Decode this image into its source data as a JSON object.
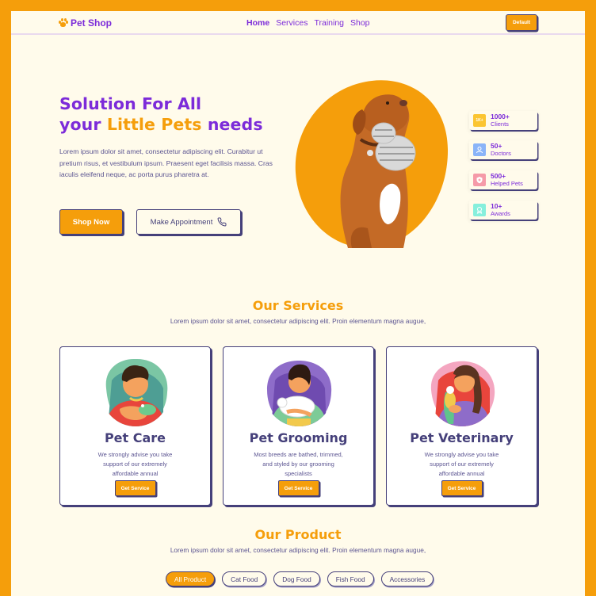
{
  "nav": {
    "brand": "Pet Shop",
    "links": [
      "Home",
      "Services",
      "Training",
      "Shop"
    ],
    "active_link": "Home",
    "button_label": "Default"
  },
  "hero": {
    "title_line1": "Solution For All",
    "title_line2_prefix": "your",
    "title_line2_accent": "Little Pets",
    "title_line2_suffix": "needs",
    "description": "Lorem ipsum dolor sit amet, consectetur adipiscing elit. Curabitur ut pretium risus, et vestibulum ipsum. Praesent eget facilisis massa. Cras iaculis eleifend neque, ac porta purus pharetra at.",
    "primary_button": "Shop Now",
    "secondary_button": "Make Appointment",
    "image": "dog-with-toy-photo"
  },
  "stats": [
    {
      "value": "1000+",
      "label": "Clients",
      "icon": "clients-icon",
      "color": "#FBC531"
    },
    {
      "value": "50+",
      "label": "Doctors",
      "icon": "doctor-icon",
      "color": "#8AB4F8"
    },
    {
      "value": "500+",
      "label": "Helped Pets",
      "icon": "shield-icon",
      "color": "#F59AA8"
    },
    {
      "value": "10+",
      "label": "Awards",
      "icon": "award-icon",
      "color": "#86EFDC"
    }
  ],
  "services": {
    "title": "Our Services",
    "subtitle": "Lorem ipsum dolor sit amet, consectetur adipiscing elit. Proin elementum magna augue,",
    "cards": [
      {
        "title": "Pet Care",
        "description": "We strongly advise you take support of our extremely affordable annual",
        "button": "Get Service",
        "illustration": "man-holding-frog"
      },
      {
        "title": "Pet Grooming",
        "description": "Most breeds are bathed, trimmed, and styled by our grooming specialists",
        "button": "Get Service",
        "illustration": "man-holding-sheep"
      },
      {
        "title": "Pet Veterinary",
        "description": "We strongly advise you take support of our extremely affordable annual",
        "button": "Get Service",
        "illustration": "woman-holding-parrot"
      }
    ]
  },
  "products": {
    "title": "Our Product",
    "subtitle": "Lorem ipsum dolor sit amet, consectetur adipiscing elit. Proin elementum magna augue,",
    "filters": [
      "All Product",
      "Cat Food",
      "Dog Food",
      "Fish Food",
      "Accessories"
    ],
    "active_filter": "All Product"
  },
  "colors": {
    "frame": "#F59E0B",
    "background": "#FFFBEB",
    "primary": "#7C2BD9",
    "accent": "#F59E0B",
    "ink": "#45407A"
  }
}
